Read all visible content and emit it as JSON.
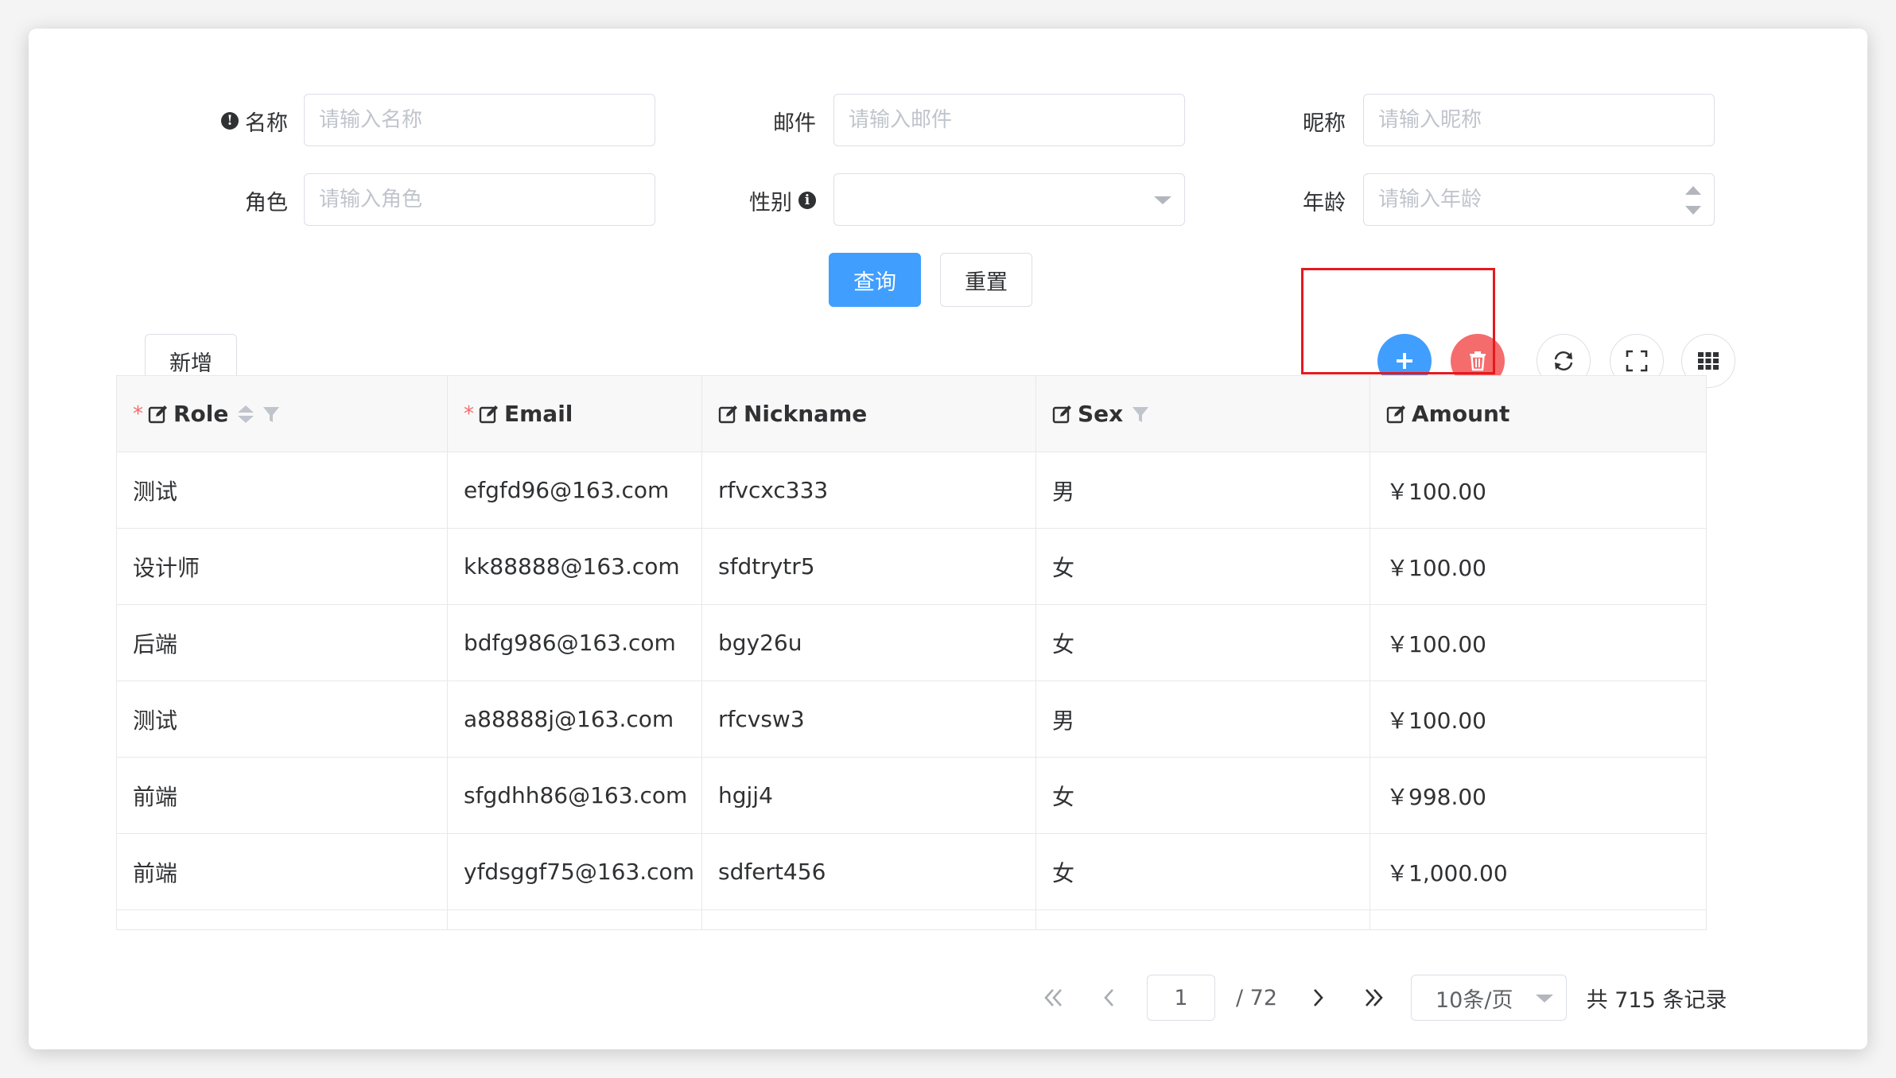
{
  "form": {
    "fields": [
      {
        "label": "名称",
        "placeholder": "请输入名称"
      },
      {
        "label": "邮件",
        "placeholder": "请输入邮件"
      },
      {
        "label": "昵称",
        "placeholder": "请输入昵称"
      },
      {
        "label": "角色",
        "placeholder": "请输入角色"
      },
      {
        "label": "性别",
        "placeholder": ""
      },
      {
        "label": "年龄",
        "placeholder": "请输入年龄"
      }
    ],
    "query_label": "查询",
    "reset_label": "重置"
  },
  "toolbar": {
    "add_label": "新增"
  },
  "table": {
    "columns": [
      "Role",
      "Email",
      "Nickname",
      "Sex",
      "Amount"
    ],
    "rows": [
      [
        "测试",
        "efgfd96@163.com",
        "rfvcxc333",
        "男",
        "￥100.00"
      ],
      [
        "设计师",
        "kk88888@163.com",
        "sfdtrytr5",
        "女",
        "￥100.00"
      ],
      [
        "后端",
        "bdfg986@163.com",
        "bgy26u",
        "女",
        "￥100.00"
      ],
      [
        "测试",
        "a88888j@163.com",
        "rfcvsw3",
        "男",
        "￥100.00"
      ],
      [
        "前端",
        "sfgdhh86@163.com",
        "hgjj4",
        "女",
        "￥998.00"
      ],
      [
        "前端",
        "yfdsggf75@163.com",
        "sdfert456",
        "女",
        "￥1,000.00"
      ]
    ]
  },
  "pager": {
    "current_page": "1",
    "total_pages": "/ 72",
    "page_size": "10条/页",
    "total": "共 715 条记录"
  },
  "colors": {
    "primary": "#409eff",
    "danger": "#f56c6c",
    "highlight": "#e5191e"
  },
  "icons": [
    "info-icon",
    "caret-down-icon",
    "spinner-icon",
    "plus-icon",
    "trash-icon",
    "refresh-icon",
    "fullscreen-icon",
    "grid-icon",
    "edit-icon",
    "sort-icon",
    "filter-icon",
    "double-left-icon",
    "left-icon",
    "right-icon",
    "double-right-icon"
  ]
}
